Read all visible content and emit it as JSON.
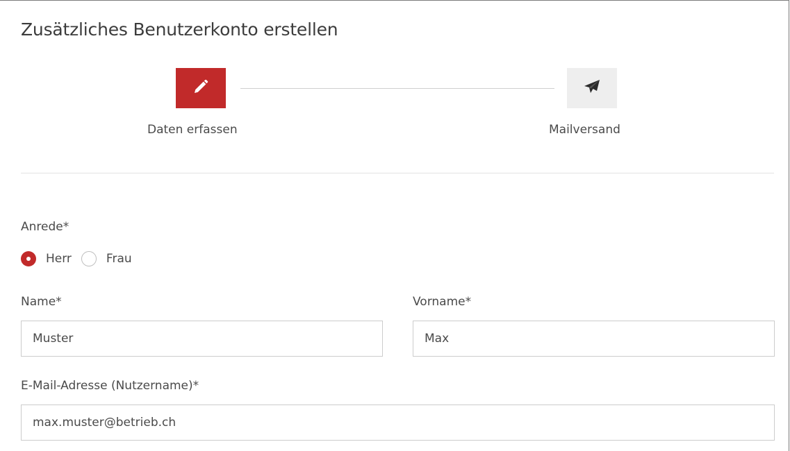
{
  "page": {
    "title": "Zusätzliches Benutzerkonto erstellen"
  },
  "steps": [
    {
      "label": "Daten erfassen",
      "icon": "pencil-icon",
      "state": "active"
    },
    {
      "label": "Mailversand",
      "icon": "paper-plane-icon",
      "state": "inactive"
    }
  ],
  "colors": {
    "accent": "#c12a2a",
    "inactive_step": "#eeeeee",
    "border": "#cccccc",
    "text": "#4a4a4a"
  },
  "form": {
    "salutation": {
      "label": "Anrede*",
      "options": [
        {
          "label": "Herr",
          "selected": true
        },
        {
          "label": "Frau",
          "selected": false
        }
      ]
    },
    "last_name": {
      "label": "Name*",
      "value": "Muster"
    },
    "first_name": {
      "label": "Vorname*",
      "value": "Max"
    },
    "email": {
      "label": "E-Mail-Adresse (Nutzername)*",
      "value": "max.muster@betrieb.ch"
    }
  }
}
